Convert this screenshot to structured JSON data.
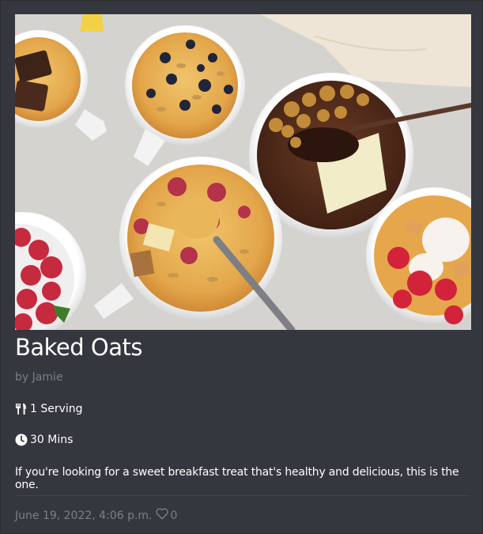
{
  "recipe": {
    "title": "Baked Oats",
    "author": "by Jamie",
    "servings": "1 Serving",
    "time": "30 Mins",
    "description": "If you're looking for a sweet breakfast treat that's healthy and delicious, this is the one.",
    "date": "June 19, 2022, 4:06 p.m.",
    "likes": "0",
    "image_alt": "Baked oats in mugs"
  },
  "icons": {
    "servings": "utensils-icon",
    "time": "clock-icon",
    "likes": "heart-icon"
  },
  "colors": {
    "card_background": "#34373d",
    "muted_text": "#7c8087",
    "title_text": "#ffffff"
  }
}
